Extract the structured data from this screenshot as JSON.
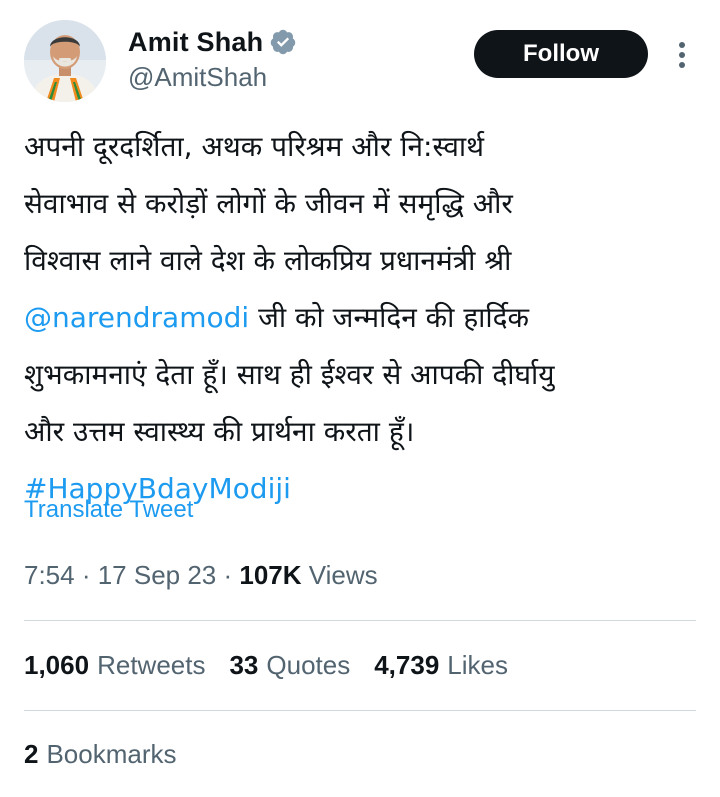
{
  "author": {
    "display_name": "Amit Shah",
    "handle": "@AmitShah",
    "verified_icon": "verified-badge-icon",
    "avatar_icon": "profile-avatar"
  },
  "actions": {
    "follow_label": "Follow",
    "more_icon": "more-vertical-icon"
  },
  "tweet": {
    "line1": "अपनी दूरदर्शिता, अथक परिश्रम और नि:स्वार्थ",
    "line2": "सेवाभाव से करोड़ों लोगों के जीवन में समृद्धि और",
    "line3": "विश्वास लाने वाले देश के लोकप्रिय प्रधानमंत्री श्री",
    "mention": "@narendramodi",
    "line4_rest": " जी को जन्मदिन की हार्दिक",
    "line5": "शुभकामनाएं देता हूँ। साथ ही ईश्वर से आपकी दीर्घायु",
    "line6": "और उत्तम स्वास्थ्य की प्रार्थना करता हूँ।",
    "hashtag": "#HappyBdayModiji"
  },
  "translate_label": "Translate Tweet",
  "meta": {
    "time": "7:54",
    "sep1": " · ",
    "date": "17 Sep 23",
    "sep2": " · ",
    "views_count": "107K",
    "views_label": " Views"
  },
  "stats": {
    "retweets_count": "1,060",
    "retweets_label": "Retweets",
    "quotes_count": "33",
    "quotes_label": "Quotes",
    "likes_count": "4,739",
    "likes_label": "Likes",
    "bookmarks_count": "2",
    "bookmarks_label": "Bookmarks"
  },
  "colors": {
    "accent": "#1d9bf0",
    "text_primary": "#0f1419",
    "text_secondary": "#536471",
    "divider": "#cfd9de",
    "follow_bg": "#0f1419"
  }
}
